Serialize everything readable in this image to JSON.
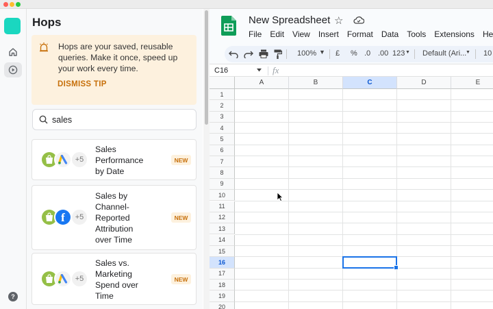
{
  "hops_panel": {
    "title": "Hops",
    "tip": {
      "text": "Hops are your saved, reusable queries. Make it once, speed up your work every time.",
      "dismiss": "DISMISS TIP"
    },
    "search": {
      "value": "sales"
    },
    "results": [
      {
        "title": "Sales Performance by Date",
        "more": "+5",
        "badge": "NEW",
        "icons": [
          "shopify-icon",
          "google-ads-icon"
        ]
      },
      {
        "title": "Sales by Channel-Reported Attribution over Time",
        "more": "+5",
        "badge": "NEW",
        "icons": [
          "shopify-icon",
          "facebook-icon"
        ]
      },
      {
        "title": "Sales vs. Marketing Spend over Time",
        "more": "+5",
        "badge": "NEW",
        "icons": [
          "shopify-icon",
          "google-ads-icon"
        ]
      }
    ],
    "help": "?"
  },
  "sheet": {
    "title": "New Spreadsheet",
    "menu": [
      "File",
      "Edit",
      "View",
      "Insert",
      "Format",
      "Data",
      "Tools",
      "Extensions",
      "Help"
    ],
    "toolbar": {
      "zoom": "100%",
      "currency": "£",
      "percent": "%",
      "dec_decrease": ".0",
      "dec_increase": ".00",
      "number_format": "123",
      "font": "Default (Ari...",
      "font_size": "10"
    },
    "name_box": "C16",
    "fx": "fx",
    "columns": [
      "A",
      "B",
      "C",
      "D",
      "E"
    ],
    "rows": [
      "1",
      "2",
      "3",
      "4",
      "5",
      "6",
      "7",
      "8",
      "9",
      "10",
      "11",
      "12",
      "13",
      "14",
      "15",
      "16",
      "17",
      "18",
      "19",
      "20"
    ],
    "selected": {
      "column": "C",
      "row": "16"
    }
  },
  "colors": {
    "accent": "#1ad7c0",
    "tip_bg": "#fdf1de",
    "tip_link": "#c7700b",
    "sheets_green": "#0f9d58",
    "selection": "#1a73e8"
  }
}
